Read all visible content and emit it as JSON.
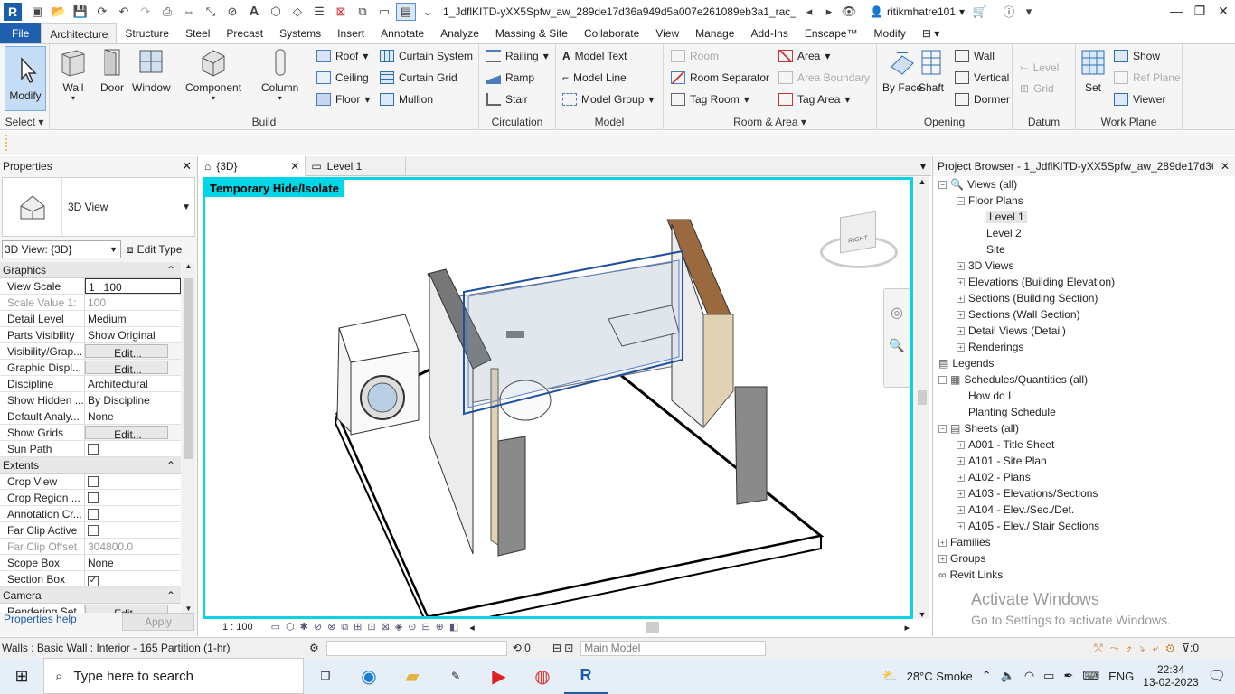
{
  "titlebar": {
    "title": "1_JdflKITD-yXX5Spfw_aw_289de17d36a949d5a007e261089eb3a1_rac_b...",
    "user": "ritikmhatre101",
    "icons": [
      "revit-logo",
      "open-icon",
      "save-icon",
      "sync-icon",
      "undo-icon",
      "redo-icon",
      "print-icon",
      "measure-icon",
      "text-icon",
      "3d-view-icon",
      "switch-windows-icon",
      "help-icon",
      "cart-icon"
    ]
  },
  "tabs": [
    "File",
    "Architecture",
    "Structure",
    "Steel",
    "Precast",
    "Systems",
    "Insert",
    "Annotate",
    "Analyze",
    "Massing & Site",
    "Collaborate",
    "View",
    "Manage",
    "Add-Ins",
    "Enscape™",
    "Modify"
  ],
  "active_tab": "Architecture",
  "ribbon": {
    "select": {
      "modify": "Modify",
      "label": "Select"
    },
    "build": {
      "label": "Build",
      "big": [
        "Wall",
        "Door",
        "Window",
        "Component",
        "Column"
      ],
      "small": [
        "Roof",
        "Ceiling",
        "Floor",
        "Curtain System",
        "Curtain Grid",
        "Mullion"
      ]
    },
    "circulation": {
      "label": "Circulation",
      "items": [
        "Railing",
        "Ramp",
        "Stair"
      ]
    },
    "model": {
      "label": "Model",
      "items": [
        "Model Text",
        "Model Line",
        "Model Group"
      ]
    },
    "room_area": {
      "label": "Room & Area",
      "items": [
        "Room",
        "Room Separator",
        "Tag Room",
        "Area",
        "Area Boundary",
        "Tag Area"
      ]
    },
    "opening": {
      "label": "Opening",
      "big": [
        "By Face",
        "Shaft"
      ],
      "items": [
        "Wall",
        "Vertical",
        "Dormer"
      ]
    },
    "datum": {
      "label": "Datum",
      "items": [
        "Level",
        "Grid"
      ]
    },
    "workplane": {
      "label": "Work Plane",
      "set": "Set",
      "items": [
        "Show",
        "Ref Plane",
        "Viewer"
      ]
    }
  },
  "properties": {
    "title": "Properties",
    "type_name": "3D View",
    "view_selector": "3D View: {3D}",
    "edit_type": "Edit Type",
    "sections": [
      {
        "name": "Graphics",
        "rows": [
          {
            "k": "View Scale",
            "v": "1 : 100"
          },
          {
            "k": "Scale Value   1:",
            "v": "100"
          },
          {
            "k": "Detail Level",
            "v": "Medium"
          },
          {
            "k": "Parts Visibility",
            "v": "Show Original"
          },
          {
            "k": "Visibility/Grap...",
            "v": "Edit..."
          },
          {
            "k": "Graphic Displ...",
            "v": "Edit..."
          },
          {
            "k": "Discipline",
            "v": "Architectural"
          },
          {
            "k": "Show Hidden ...",
            "v": "By Discipline"
          },
          {
            "k": "Default Analy...",
            "v": "None"
          },
          {
            "k": "Show Grids",
            "v": "Edit..."
          },
          {
            "k": "Sun Path",
            "v": ""
          }
        ]
      },
      {
        "name": "Extents",
        "rows": [
          {
            "k": "Crop View",
            "v": ""
          },
          {
            "k": "Crop Region ...",
            "v": ""
          },
          {
            "k": "Annotation Cr...",
            "v": ""
          },
          {
            "k": "Far Clip Active",
            "v": ""
          },
          {
            "k": "Far Clip Offset",
            "v": "304800.0"
          },
          {
            "k": "Scope Box",
            "v": "None"
          },
          {
            "k": "Section Box",
            "v": ""
          }
        ]
      },
      {
        "name": "Camera",
        "rows": [
          {
            "k": "Rendering Set...",
            "v": "Edit..."
          }
        ]
      }
    ],
    "help": "Properties help",
    "apply": "Apply"
  },
  "view_tabs": [
    {
      "label": "{3D}",
      "active": true
    },
    {
      "label": "Level 1",
      "active": false
    }
  ],
  "canvas": {
    "banner": "Temporary Hide/Isolate",
    "scale": "1 : 100",
    "viewcube_face": "RIGHT",
    "viewcube_top": "TOP"
  },
  "browser": {
    "title": "Project Browser - 1_JdflKITD-yXX5Spfw_aw_289de17d36a...",
    "items": [
      {
        "label": "Views (all)",
        "level": 0,
        "exp": "-"
      },
      {
        "label": "Floor Plans",
        "level": 1,
        "exp": "-"
      },
      {
        "label": "Level 1",
        "level": 2,
        "exp": ""
      },
      {
        "label": "Level 2",
        "level": 2,
        "exp": ""
      },
      {
        "label": "Site",
        "level": 2,
        "exp": ""
      },
      {
        "label": "3D Views",
        "level": 1,
        "exp": "+"
      },
      {
        "label": "Elevations (Building Elevation)",
        "level": 1,
        "exp": "+"
      },
      {
        "label": "Sections (Building Section)",
        "level": 1,
        "exp": "+"
      },
      {
        "label": "Sections (Wall Section)",
        "level": 1,
        "exp": "+"
      },
      {
        "label": "Detail Views (Detail)",
        "level": 1,
        "exp": "+"
      },
      {
        "label": "Renderings",
        "level": 1,
        "exp": "+"
      },
      {
        "label": "Legends",
        "level": 0,
        "exp": ""
      },
      {
        "label": "Schedules/Quantities (all)",
        "level": 0,
        "exp": "-"
      },
      {
        "label": "How do I",
        "level": 1,
        "exp": ""
      },
      {
        "label": "Planting Schedule",
        "level": 1,
        "exp": ""
      },
      {
        "label": "Sheets (all)",
        "level": 0,
        "exp": "-"
      },
      {
        "label": "A001 - Title Sheet",
        "level": 1,
        "exp": "+"
      },
      {
        "label": "A101 - Site Plan",
        "level": 1,
        "exp": "+"
      },
      {
        "label": "A102 - Plans",
        "level": 1,
        "exp": "+"
      },
      {
        "label": "A103 - Elevations/Sections",
        "level": 1,
        "exp": "+"
      },
      {
        "label": "A104 - Elev./Sec./Det.",
        "level": 1,
        "exp": "+"
      },
      {
        "label": "A105 - Elev./ Stair Sections",
        "level": 1,
        "exp": "+"
      },
      {
        "label": "Families",
        "level": 0,
        "exp": "+"
      },
      {
        "label": "Groups",
        "level": 0,
        "exp": "+"
      },
      {
        "label": "Revit Links",
        "level": 0,
        "exp": ""
      }
    ],
    "activate_title": "Activate Windows",
    "activate_sub": "Go to Settings to activate Windows."
  },
  "status": {
    "text": "Walls : Basic Wall : Interior - 165 Partition (1-hr)",
    "zero1": ":0",
    "model": "Main Model",
    "zero2": ":0"
  },
  "taskbar": {
    "search": "Type here to search",
    "weather": "28°C  Smoke",
    "lang": "ENG",
    "time": "22:34",
    "date": "13-02-2023"
  },
  "colors": {
    "accent": "#1f5fb0",
    "isolate": "#00d6e6"
  }
}
